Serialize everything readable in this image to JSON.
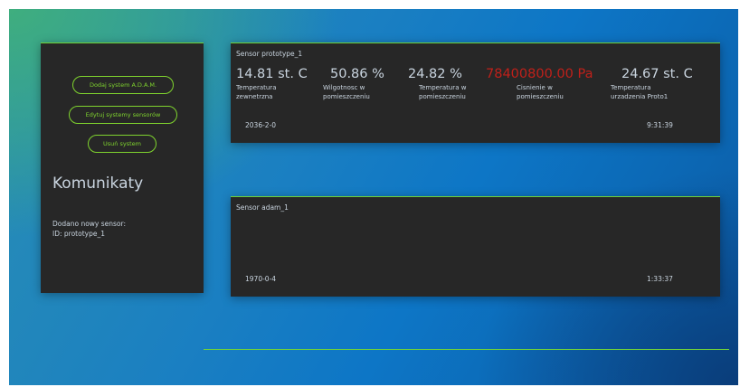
{
  "left_panel": {
    "buttons": {
      "add_label": "Dodaj system A.D.A.M.",
      "edit_label": "Edytuj systemy sensorów",
      "delete_label": "Usuń system"
    },
    "messages_title": "Komunikaty",
    "messages": [
      "Dodano nowy sensor:",
      "ID: prototype_1"
    ]
  },
  "sensors": [
    {
      "title": "Sensor prototype_1",
      "readings": [
        {
          "value": "14.81 st. C",
          "label_lines": [
            "Temperatura",
            "zewnetrzna"
          ],
          "alert": false
        },
        {
          "value": "50.86 %",
          "label_lines": [
            "Wilgotnosc w",
            "pomieszczeniu"
          ],
          "alert": false
        },
        {
          "value": "24.82 %",
          "label_lines": [
            "Temperatura w",
            "pomieszczeniu"
          ],
          "alert": false
        },
        {
          "value": "78400800.00 Pa",
          "label_lines": [
            "Cisnienie w",
            "pomieszczeniu"
          ],
          "alert": true
        },
        {
          "value": "24.67 st. C",
          "label_lines": [
            "Temperatura",
            "urzadzenia Proto1"
          ],
          "alert": false
        }
      ],
      "date": "2036-2-0",
      "time": "9:31:39"
    },
    {
      "title": "Sensor adam_1",
      "readings": [],
      "date": "1970-0-4",
      "time": "1:33:37"
    }
  ],
  "colors": {
    "accent": "#7fd32e",
    "panel": "#272727",
    "text": "#c9d4df",
    "alert": "#c0201a"
  }
}
